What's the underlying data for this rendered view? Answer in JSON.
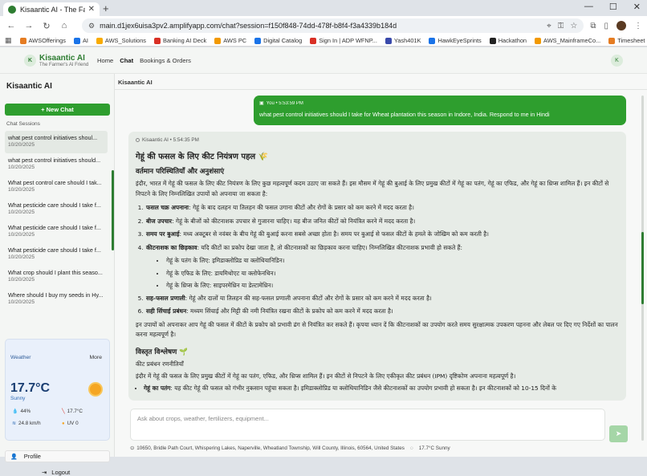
{
  "browser": {
    "tab_title": "Kisaantic AI - The Farmer's AI Fr",
    "tab_close": "✕",
    "new_tab": "+",
    "window_controls": [
      "—",
      "☐",
      "✕"
    ],
    "url": "main.d1jex6uisa3pv2.amplifyapp.com/chat?session=f150f848-74dd-478f-b8f4-f3a4339b184d",
    "bookmarks": [
      {
        "label": "AWSOfferings",
        "color": "#e57c22"
      },
      {
        "label": "AI",
        "color": "#1a73e8"
      },
      {
        "label": "AWS_Solutions",
        "color": "#f9ab00"
      },
      {
        "label": "Banking AI Deck",
        "color": "#d93025"
      },
      {
        "label": "AWS PC",
        "color": "#f29900"
      },
      {
        "label": "Digital Catalog",
        "color": "#1a73e8"
      },
      {
        "label": "Sign In | ADP WFNP...",
        "color": "#d93025"
      },
      {
        "label": "Yash401K",
        "color": "#3949ab"
      },
      {
        "label": "HawkEyeSprints",
        "color": "#1a73e8"
      },
      {
        "label": "Hackathon",
        "color": "#222222"
      },
      {
        "label": "AWS_MainframeCo...",
        "color": "#f29900"
      },
      {
        "label": "Timesheet",
        "color": "#e57c22"
      },
      {
        "label": "Zoho Expense",
        "color": "#d93025"
      }
    ]
  },
  "app": {
    "logo_letter": "K",
    "brand_name": "Kisaantic AI",
    "brand_tagline": "The Farmer's AI Friend",
    "nav": [
      "Home",
      "Chat",
      "Bookings & Orders"
    ],
    "user_initial": "K"
  },
  "sidebar": {
    "title": "Kisaantic AI",
    "new_chat": "+ New Chat",
    "sessions_label": "Chat Sessions",
    "sessions": [
      {
        "title": "what pest control initiatives shoul...",
        "date": "10/20/2025"
      },
      {
        "title": "what pest control initiatives should...",
        "date": "10/20/2025"
      },
      {
        "title": "What pest control care should I tak...",
        "date": "10/20/2025"
      },
      {
        "title": "What pesticide care should I take f...",
        "date": "10/20/2025"
      },
      {
        "title": "What pesticide care should I take f...",
        "date": "10/20/2025"
      },
      {
        "title": "What pesticide care should I take f...",
        "date": "10/20/2025"
      },
      {
        "title": "What crop should I plant this seaso...",
        "date": "10/20/2025"
      },
      {
        "title": "Where should I buy my seeds in Hy...",
        "date": "10/20/2025"
      }
    ],
    "weather": {
      "title": "Weather",
      "more": "More",
      "temp": "17.7°C",
      "condition": "Sunny",
      "humidity": "44%",
      "feels": "17.7°C",
      "visibility": "24.8 km/h",
      "uv": "UV 0"
    },
    "profile": "Profile",
    "logout": "Logout"
  },
  "main": {
    "title": "Kisaantic AI",
    "user_message": {
      "meta": "You • 5:53:59 PM",
      "text": "what pest control initiatives should I take for Wheat plantation this season in Indore, India. Respond to me in Hindi"
    },
    "ai_message": {
      "meta": "Kisaantic AI • 5:54:35 PM",
      "h1": "गेहूं की फसल के लिए कीट नियंत्रण पहल 🌾",
      "h2a": "वर्तमान परिस्थितियाँ और अनुशंसाएं",
      "intro": "इंदौर, भारत में गेहूं की फसल के लिए कीट नियंत्रण के लिए कुछ महत्वपूर्ण कदम उठाए जा सकते हैं। इस मौसम में गेहूं की बुआई के लिए प्रमुख कीटों में गेहूं का पतंग, गेहूं का एफिड, और गेहूं का थ्रिप्स शामिल हैं। इन कीटों से निपटने के लिए निम्नलिखित उपायों को अपनाया जा सकता है:",
      "items": [
        {
          "b": "फसल चक्र अपनाना",
          "t": ": गेहूं के बाद दलहन या तिलहन की फसल उगाना कीटों और रोगों के प्रसार को कम करने में मदद करता है।"
        },
        {
          "b": "बीज उपचार",
          "t": ": गेहूं के बीजों को कीटनाशक उपचार से गुजारना चाहिए। यह बीज जनित कीटों को नियंत्रित करने में मदद करता है।"
        },
        {
          "b": "समय पर बुआई",
          "t": ": मध्य अक्टूबर से नवंबर के बीच गेहूं की बुआई करना सबसे अच्छा होता है। समय पर बुआई से फसल कीटों के हमले के जोखिम को कम करती है।"
        },
        {
          "b": "कीटनाशक का छिड़काव",
          "t": ": यदि कीटों का प्रकोप देखा जाता है, तो कीटनाशकों का छिड़काव करना चाहिए। निम्नलिखित कीटनाशक प्रभावी हो सकते हैं:"
        }
      ],
      "sub_items": [
        "गेहूं के पतंग के लिए: इमिडाक्लोप्रिड या क्लोथियानिडिन।",
        "गेहूं के एफिड के लिए: डायमिथोएट या क्लोफेनथिन।",
        "गेहूं के थ्रिप्स के लिए: साइपरमेथ्रिन या डेल्टामेथ्रिन।"
      ],
      "items2": [
        {
          "b": "सह-फसल प्रणाली",
          "t": ": गेहूं और दालों या तिलहन की सह-फसल प्रणाली अपनाना कीटों और रोगों के प्रसार को कम करने में मदद करता है।"
        },
        {
          "b": "सही सिंचाई प्रबंधन",
          "t": ": मध्यम सिंचाई और मिट्टी की नमी नियंत्रित रखना कीटों के प्रकोप को कम करने में मदद करता है।"
        }
      ],
      "outro": "इन उपायों को अपनाकर आप गेहूं की फसल में कीटों के प्रकोप को प्रभावी ढंग से नियंत्रित कर सकते हैं। कृपया ध्यान दें कि कीटनाशकों का उपयोग करते समय सुरक्षात्मक उपकरण पहनना और लेबल पर दिए गए निर्देशों का पालन करना महत्वपूर्ण है।",
      "h2b": "विस्तृत विश्लेषण 🌱",
      "sub_heading": "कीट प्रबंधन रणनीतियाँ",
      "para2": "इंदौर में गेहूं की फसल के लिए प्रमुख कीटों में गेहूं का पतंग, एफिड, और थ्रिप्स शामिल हैं। इन कीटों से निपटने के लिए एकीकृत कीट प्रबंधन (IPM) दृष्टिकोण अपनाना महत्वपूर्ण है।",
      "bullet_b": "गेहूं का पतंग",
      "bullet_t": ": यह कीट गेहूं की फसल को गंभीर नुकसान पहुंचा सकता है। इमिडाक्लोप्रिड या क्लोथियानिडिन जैसे कीटनाशकों का उपयोग प्रभावी हो सकता है। इन कीटनाशकों को 10-15 दिनों के"
    },
    "composer_placeholder": "Ask about crops, weather, fertilizers, equipment...",
    "location": "10650, Bridle Path Court, Whispering Lakes, Naperville, Wheatland Township, Will County, Illinois, 60564, United States",
    "location_weather": "17.7°C Sunny"
  }
}
